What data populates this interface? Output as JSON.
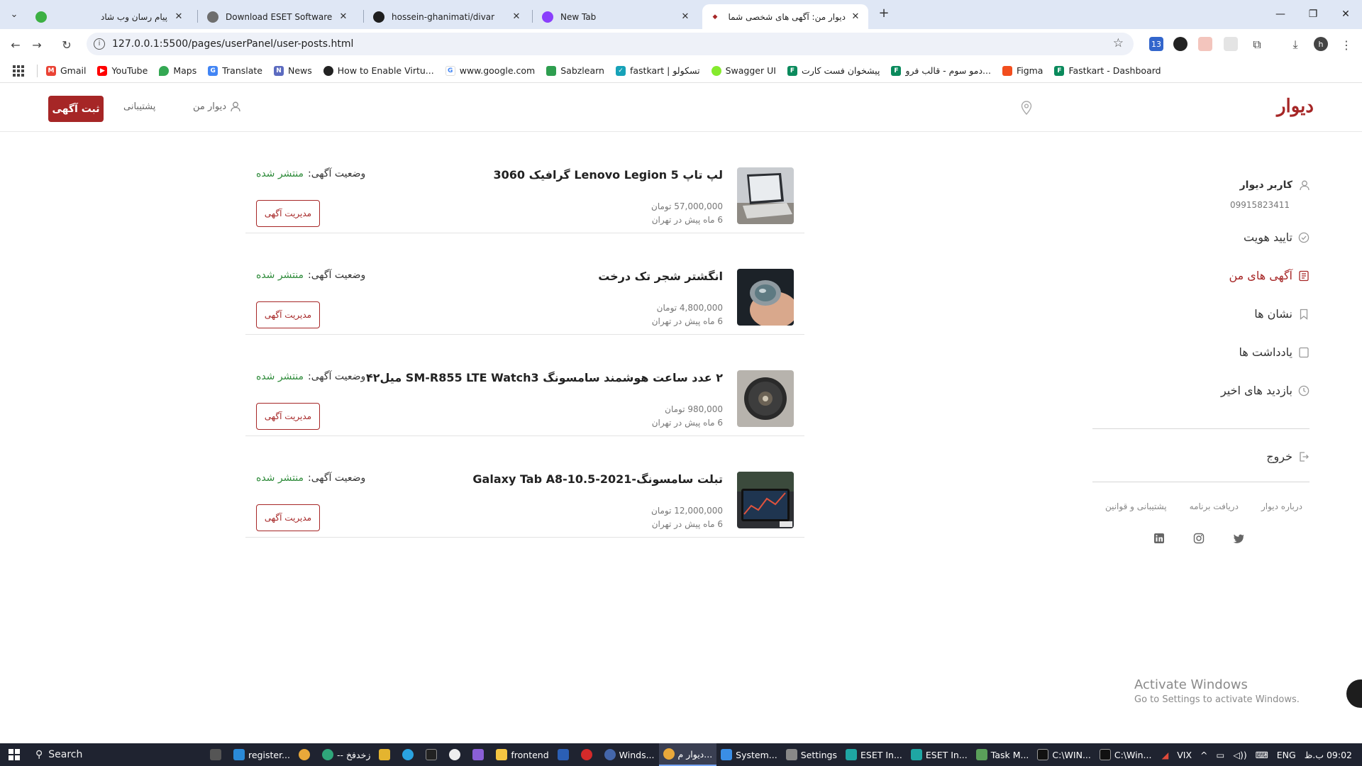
{
  "browser": {
    "tabs": [
      {
        "label": "پیام رسان وب شاد",
        "color": "#3cb043"
      },
      {
        "label": "Download ESET Software",
        "color": "#6e6e6e"
      },
      {
        "label": "hossein-ghanimati/divar",
        "color": "#1f1f1f"
      },
      {
        "label": "New Tab",
        "color": "#8a3ffc"
      },
      {
        "label": "دیوار من: آگهی های شخصی شما",
        "color": "#a62626"
      }
    ],
    "url": "127.0.0.1:5500/pages/userPanel/user-posts.html",
    "extension_badge": "13",
    "profile_initial": "h",
    "bookmarks": [
      "Gmail",
      "YouTube",
      "Maps",
      "Translate",
      "News",
      "How to Enable Virtu...",
      "www.google.com",
      "Sabzlearn",
      "fastkart | تسکولو",
      "Swagger UI",
      "پیشخوان فست کارت",
      "دمو سوم - قالب فرو...",
      "Figma",
      "Fastkart - Dashboard"
    ]
  },
  "site": {
    "logo": "دیوار",
    "post_ad": "ثبت آگهی",
    "support": "پشتیبانی",
    "my_divar": "دیوار من"
  },
  "sidebar": {
    "user_name": "کاربر دیوار",
    "phone": "09915823411",
    "items": [
      {
        "label": "تایید هویت"
      },
      {
        "label": "آگهی های من"
      },
      {
        "label": "نشان ها"
      },
      {
        "label": "یادداشت ها"
      },
      {
        "label": "بازدید های اخیر"
      }
    ],
    "logout": "خروج",
    "footer_links": [
      "درباره دیوار",
      "دریافت برنامه",
      "پشتیبانی و قوانین"
    ]
  },
  "posts": [
    {
      "title": "لپ تاپ Lenovo Legion 5 گرافیک 3060",
      "price": "57,000,000 تومان",
      "time": "6 ماه پیش در تهران",
      "status_label": "وضعیت آگهی:",
      "status_value": "منتشر شده",
      "manage": "مدیریت آگهی"
    },
    {
      "title": "انگشتر شجر تک درخت",
      "price": "4,800,000 تومان",
      "time": "6 ماه پیش در تهران",
      "status_label": "وضعیت آگهی:",
      "status_value": "منتشر شده",
      "manage": "مدیریت آگهی"
    },
    {
      "title": "۲ عدد ساعت هوشمند سامسونگ SM-R855 LTE Watch3 میل۴۲",
      "price": "980,000 تومان",
      "time": "6 ماه پیش در تهران",
      "status_label": "وضعیت آگهی:",
      "status_value": "منتشر شده",
      "manage": "مدیریت آگهی"
    },
    {
      "title": "تبلت سامسونگ-Galaxy Tab A8-10.5-2021",
      "price": "12,000,000 تومان",
      "time": "6 ماه پیش در تهران",
      "status_label": "وضعیت آگهی:",
      "status_value": "منتشر شده",
      "manage": "مدیریت آگهی"
    }
  ],
  "watermark": {
    "line1": "Activate Windows",
    "line2": "Go to Settings to activate Windows."
  },
  "taskbar": {
    "search": "Search",
    "apps": [
      "register...",
      "-- زخدفخ",
      "frontend",
      "Winds...",
      "دیوار م...",
      "System...",
      "Settings",
      "ESET In...",
      "ESET In...",
      "Task M...",
      "C:\\WIN...",
      "C:\\Win..."
    ],
    "tray_app": "VIX",
    "lang": "ENG",
    "clock": "09:02 ب.ظ"
  }
}
